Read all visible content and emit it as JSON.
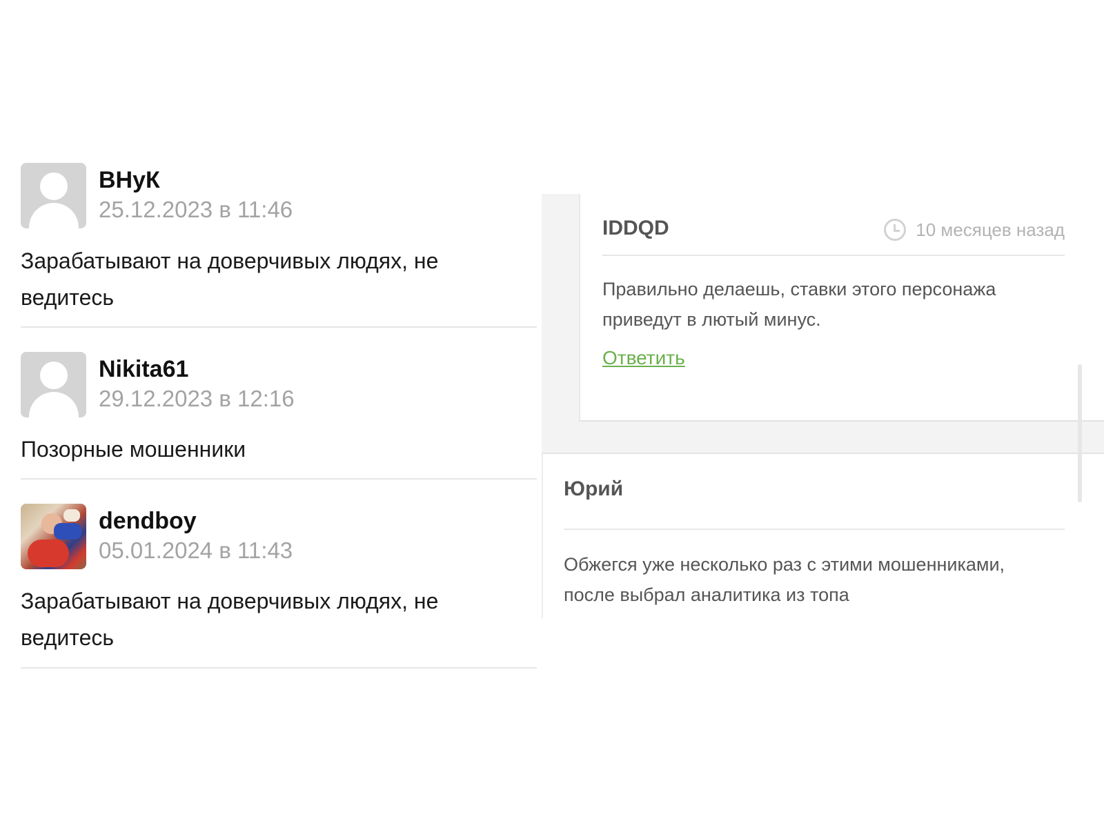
{
  "left_comments": [
    {
      "username": "ВНуК",
      "date": "25.12.2023 в 11:46",
      "text": "Зарабатывают на доверчивых людях, не ведитесь"
    },
    {
      "username": "Nikita61",
      "date": "29.12.2023 в 12:16",
      "text": "Позорные мошенники"
    },
    {
      "username": "dendboy",
      "date": "05.01.2024 в 11:43",
      "text": "Зарабатывают на доверчивых людях, не ведитесь"
    }
  ],
  "reply": {
    "author": "IDDQD",
    "time_icon": "clock-icon",
    "time": "10 месяцев назад",
    "text": "Правильно делаешь, ставки этого персонажа приведут в лютый минус.",
    "reply_link": "Ответить"
  },
  "second_comment": {
    "author": "Юрий",
    "text": "Обжегся уже несколько раз с этими мошенниками, после выбрал аналитика из топа"
  },
  "colors": {
    "link_green": "#6ab04c",
    "date_gray": "#a3a3a3",
    "panel_bg": "#f3f3f3"
  }
}
